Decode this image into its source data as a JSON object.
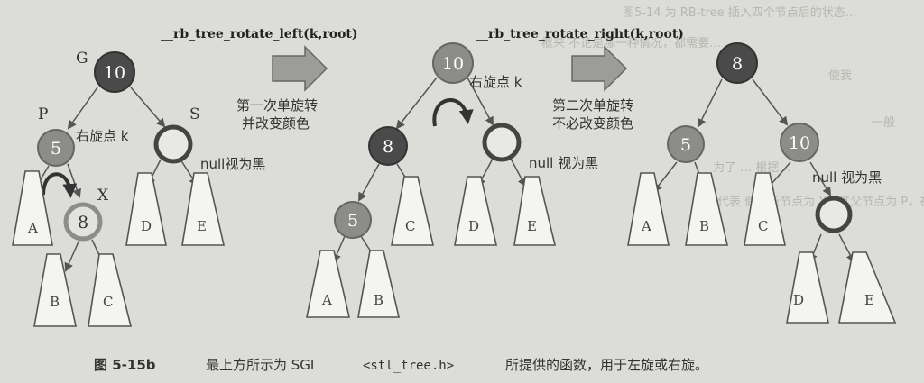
{
  "figure": {
    "function_left": "__rb_tree_rotate_left(k,root)",
    "function_right": "__rb_tree_rotate_right(k,root)",
    "step1": [
      "第一次单旋转",
      "并改变颜色"
    ],
    "step2": [
      "第二次单旋转",
      "不必改变颜色"
    ],
    "colors": {
      "black_node": "#4a4a4a",
      "red_node": "#8c8c8a",
      "arrow_fill": "#9c9c99",
      "paper": "#dcdcd8"
    }
  },
  "diagram1": {
    "label_G": "G",
    "label_P": "P",
    "label_S": "S",
    "label_X": "X",
    "rotate_point": "右旋点 k",
    "null_label": "null视为黑",
    "node_G": "10",
    "node_P": "5",
    "node_X": "8",
    "sub_A": "A",
    "sub_B": "B",
    "sub_C": "C",
    "sub_D": "D",
    "sub_E": "E"
  },
  "diagram2": {
    "rotate_point": "右旋点 k",
    "null_label": "null 视为黑",
    "node_root": "10",
    "node_8": "8",
    "node_5": "5",
    "sub_A": "A",
    "sub_B": "B",
    "sub_C": "C",
    "sub_D": "D",
    "sub_E": "E"
  },
  "diagram3": {
    "null_label": "null 视为黑",
    "node_root": "8",
    "node_5": "5",
    "node_10": "10",
    "sub_A": "A",
    "sub_B": "B",
    "sub_C": "C",
    "sub_D": "D",
    "sub_E": "E"
  },
  "caption": {
    "figure_label": "图 5-15b",
    "text_before": "最上方所示为 SGI",
    "header": "<stl_tree.h>",
    "text_after": "所提供的函数，用于左旋或右旋。"
  },
  "background_text": [
    "图5-14 为 RB-tree 插入四个节点后的状态…",
    "框来 不论是哪一种情况，都需要…",
    "使我",
    "为了 … 根据…",
    "一般",
    "代表 假设新节点为 X，其父节点为 P，祖父节点为 G…"
  ]
}
